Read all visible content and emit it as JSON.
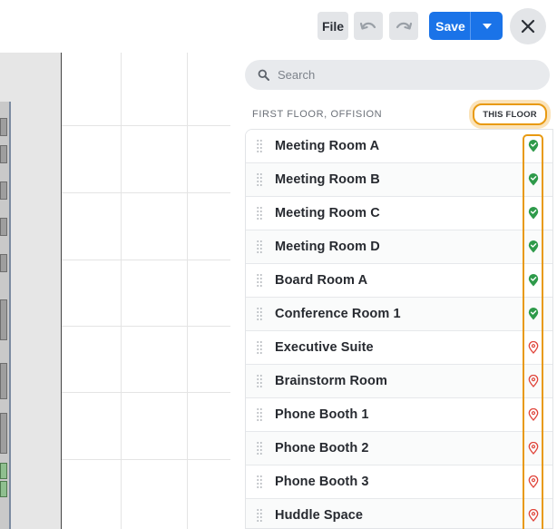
{
  "toolbar": {
    "file_label": "File",
    "save_label": "Save"
  },
  "search": {
    "placeholder": "Search",
    "value": ""
  },
  "section": {
    "title": "FIRST FLOOR, OFFISION",
    "filter_chip": "THIS FLOOR"
  },
  "rooms": [
    {
      "name": "Meeting Room A",
      "placed": true
    },
    {
      "name": "Meeting Room B",
      "placed": true
    },
    {
      "name": "Meeting Room C",
      "placed": true
    },
    {
      "name": "Meeting Room D",
      "placed": true
    },
    {
      "name": "Board Room A",
      "placed": true
    },
    {
      "name": "Conference Room 1",
      "placed": true
    },
    {
      "name": "Executive Suite",
      "placed": false
    },
    {
      "name": "Brainstorm Room",
      "placed": false
    },
    {
      "name": "Phone Booth 1",
      "placed": false
    },
    {
      "name": "Phone Booth 2",
      "placed": false
    },
    {
      "name": "Phone Booth 3",
      "placed": false
    },
    {
      "name": "Huddle Space",
      "placed": false
    }
  ],
  "colors": {
    "accent": "#1a73e8",
    "highlight": "#e89a12",
    "placed_pin": "#2e9a4a",
    "unplaced_pin": "#e0443a"
  },
  "icons": {
    "undo": "undo-icon",
    "redo": "redo-icon",
    "caret": "caret-down-icon",
    "close": "close-icon",
    "search": "search-icon",
    "drag": "drag-handle-icon",
    "placed": "pin-check-icon",
    "unplaced": "pin-outline-icon"
  }
}
